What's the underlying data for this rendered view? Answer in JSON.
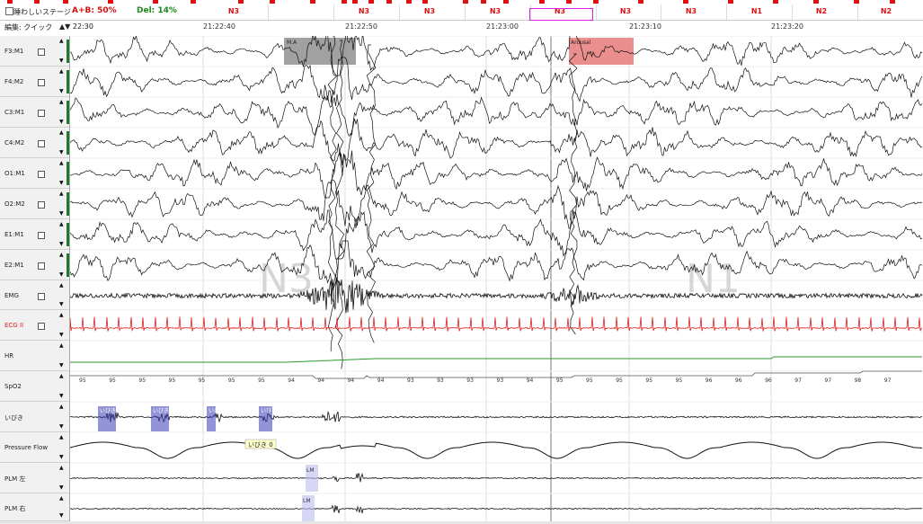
{
  "header": {
    "checkbox_label": "睡わしいステージ",
    "ab_label": "A+B: 50%",
    "del_label": "Del: 14%",
    "edit_label": "編集: クイック",
    "time_ref": "22:30"
  },
  "stages": [
    "N3",
    "N3",
    "N3",
    "N3",
    "N3",
    "N3",
    "N3",
    "N1",
    "N2",
    "N2",
    "N2"
  ],
  "time_ticks": [
    "21:22:40",
    "21:22:50",
    "21:23:00",
    "21:23:10",
    "21:23:20"
  ],
  "channels": [
    {
      "name": "F3:M1",
      "has_check": true
    },
    {
      "name": "F4:M2",
      "has_check": true
    },
    {
      "name": "C3:M1",
      "has_check": true
    },
    {
      "name": "C4:M2",
      "has_check": true
    },
    {
      "name": "O1:M1",
      "has_check": true
    },
    {
      "name": "O2:M2",
      "has_check": true
    },
    {
      "name": "E1:M1",
      "has_check": true
    },
    {
      "name": "E2:M1",
      "has_check": true
    },
    {
      "name": "EMG",
      "has_check": true
    },
    {
      "name": "ECG II",
      "has_check": true
    },
    {
      "name": "HR",
      "has_check": false
    },
    {
      "name": "SpO2",
      "has_check": false
    },
    {
      "name": "いびき",
      "has_check": false
    },
    {
      "name": "Pressure Flow",
      "has_check": false
    },
    {
      "name": "PLM 左",
      "has_check": false
    },
    {
      "name": "PLM 右",
      "has_check": false
    }
  ],
  "event_labels": {
    "ma": "M.A",
    "arousal": "Arousal",
    "snore": "いびき",
    "snore_tip": "いびき 0",
    "lm": "LM"
  },
  "watermark_n3": "N3",
  "watermark_n1": "N1",
  "spo2_values": [
    "95",
    "95",
    "95",
    "95",
    "95",
    "95",
    "95",
    "94",
    "94",
    "94",
    "94",
    "93",
    "93",
    "93",
    "93",
    "94",
    "95",
    "95",
    "95",
    "95",
    "95",
    "96",
    "96",
    "96",
    "97",
    "97",
    "98",
    "97"
  ],
  "colors": {
    "stage": "#d11111",
    "ab": "#d11111",
    "del": "#1c8a1c",
    "ecg": "#e02020",
    "hr": "#2a9a2a",
    "ma_box": "#888888",
    "arousal_box": "#e77a7a",
    "snore_box": "#3b3bb8",
    "selection": "#e020e0"
  }
}
